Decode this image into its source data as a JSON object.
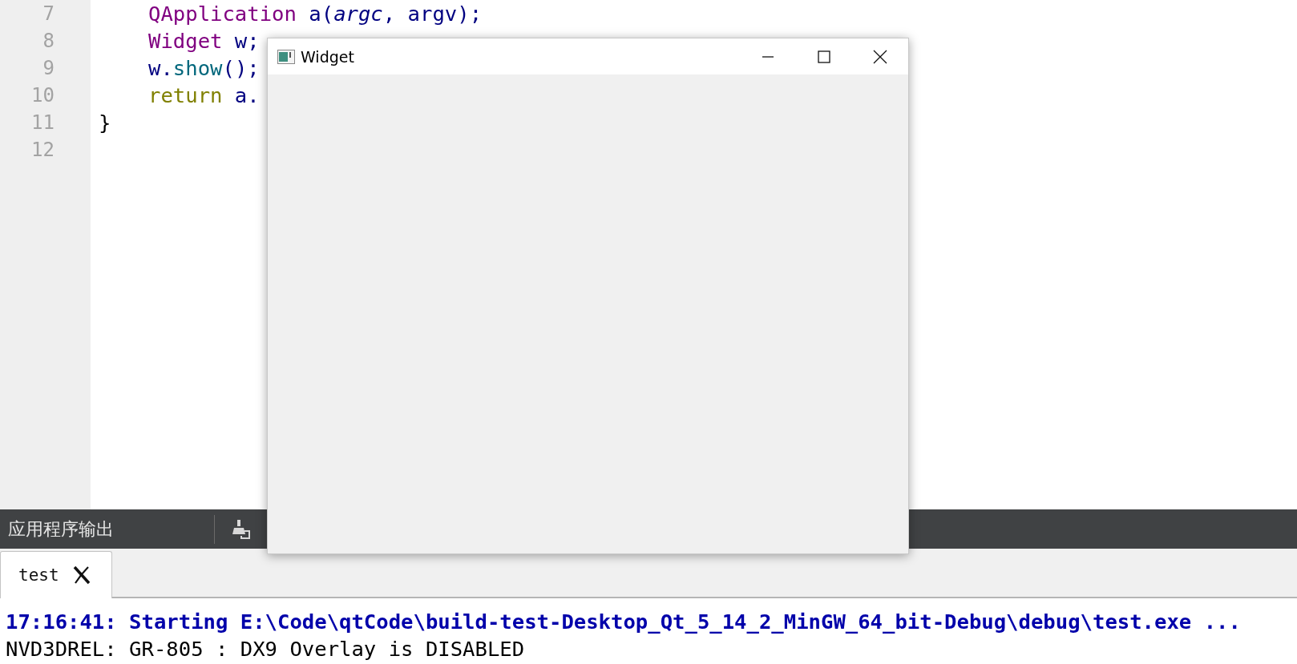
{
  "editor": {
    "lines": [
      {
        "number": "7",
        "indented": true,
        "tokens": [
          {
            "kind": "type",
            "text": "QApplication"
          },
          {
            "kind": "plain",
            "text": " a("
          },
          {
            "kind": "param",
            "text": "argc"
          },
          {
            "kind": "plain",
            "text": ", argv);"
          }
        ]
      },
      {
        "number": "8",
        "indented": true,
        "tokens": [
          {
            "kind": "type",
            "text": "Widget"
          },
          {
            "kind": "plain",
            "text": " w;"
          }
        ]
      },
      {
        "number": "9",
        "indented": true,
        "tokens": [
          {
            "kind": "plain",
            "text": "w."
          },
          {
            "kind": "method",
            "text": "show"
          },
          {
            "kind": "plain",
            "text": "();"
          }
        ]
      },
      {
        "number": "10",
        "indented": true,
        "tokens": [
          {
            "kind": "keyword",
            "text": "return"
          },
          {
            "kind": "plain",
            "text": " a."
          }
        ]
      },
      {
        "number": "11",
        "indented": false,
        "tokens": [
          {
            "kind": "brace",
            "text": "}"
          }
        ]
      },
      {
        "number": "12"
      }
    ]
  },
  "output_pane": {
    "title": "应用程序输出",
    "tabs": [
      {
        "label": "test",
        "selected": true
      }
    ],
    "lines": [
      {
        "kind": "status",
        "text": "17:16:41: Starting E:\\Code\\qtCode\\build-test-Desktop_Qt_5_14_2_MinGW_64_bit-Debug\\debug\\test.exe ..."
      },
      {
        "kind": "plain",
        "text": "NVD3DREL: GR-805 : DX9 Overlay is DISABLED"
      }
    ]
  },
  "app_window": {
    "title": "Widget"
  }
}
